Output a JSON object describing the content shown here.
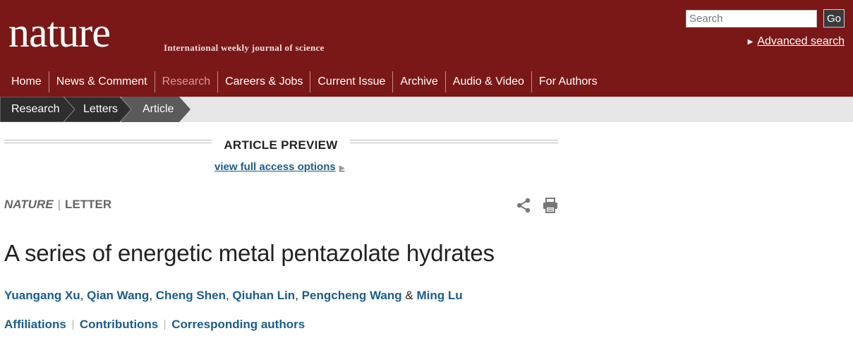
{
  "header": {
    "logo": "nature",
    "tagline": "International weekly journal of science",
    "search": {
      "placeholder": "Search",
      "value": "",
      "button": "Go"
    },
    "advanced_search": "Advanced search"
  },
  "nav": [
    {
      "label": "Home",
      "active": false
    },
    {
      "label": "News & Comment",
      "active": false
    },
    {
      "label": "Research",
      "active": true
    },
    {
      "label": "Careers & Jobs",
      "active": false
    },
    {
      "label": "Current Issue",
      "active": false
    },
    {
      "label": "Archive",
      "active": false
    },
    {
      "label": "Audio & Video",
      "active": false
    },
    {
      "label": "For Authors",
      "active": false
    }
  ],
  "breadcrumb": [
    "Research",
    "Letters",
    "Article"
  ],
  "preview": {
    "label": "ARTICLE PREVIEW",
    "link": "view full access options"
  },
  "meta": {
    "journal": "NATURE",
    "separator": "|",
    "type": "LETTER"
  },
  "icons": {
    "share": "share-icon",
    "print": "print-icon"
  },
  "article": {
    "title": "A series of energetic metal pentazolate hydrates",
    "authors": [
      "Yuangang Xu",
      "Qian Wang",
      "Cheng Shen",
      "Qiuhan Lin",
      "Pengcheng Wang",
      "Ming Lu"
    ],
    "author_separator": ",",
    "author_last_joiner": "&"
  },
  "links": [
    "Affiliations",
    "Contributions",
    "Corresponding authors"
  ],
  "colors": {
    "header_bg": "#7a1818",
    "link": "#1a5d8a",
    "breadcrumb_dark": "#2e2e2e",
    "breadcrumb_active": "#5a5a5a"
  }
}
